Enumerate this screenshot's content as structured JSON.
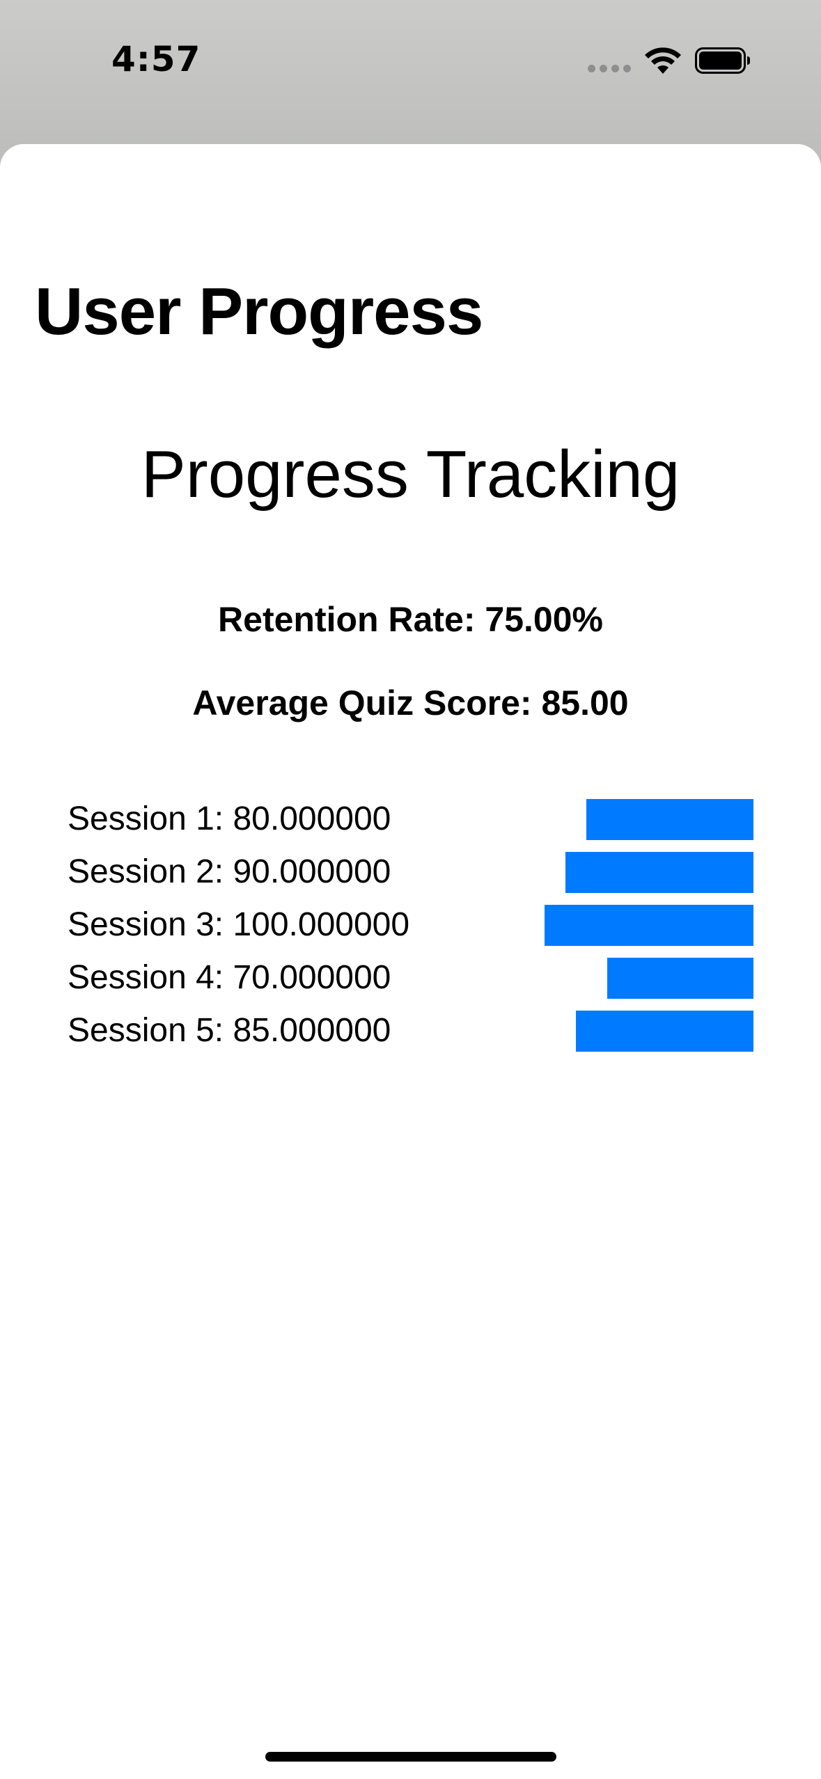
{
  "status_bar": {
    "time": "4:57",
    "icons": [
      "cellular-signal-icon",
      "wifi-icon",
      "battery-icon"
    ]
  },
  "screen": {
    "title": "User Progress",
    "heading": "Progress Tracking",
    "retention_rate": "Retention Rate: 75.00%",
    "average_quiz_score": "Average Quiz Score: 85.00"
  },
  "sessions": [
    {
      "label": "Session 1: 80.000000",
      "score": 80
    },
    {
      "label": "Session 2: 90.000000",
      "score": 90
    },
    {
      "label": "Session 3: 100.000000",
      "score": 100
    },
    {
      "label": "Session 4: 70.000000",
      "score": 70
    },
    {
      "label": "Session 5: 85.000000",
      "score": 85
    }
  ],
  "colors": {
    "bar": "#007aff",
    "background": "#ffffff",
    "backdrop": "#c4c5c3"
  }
}
